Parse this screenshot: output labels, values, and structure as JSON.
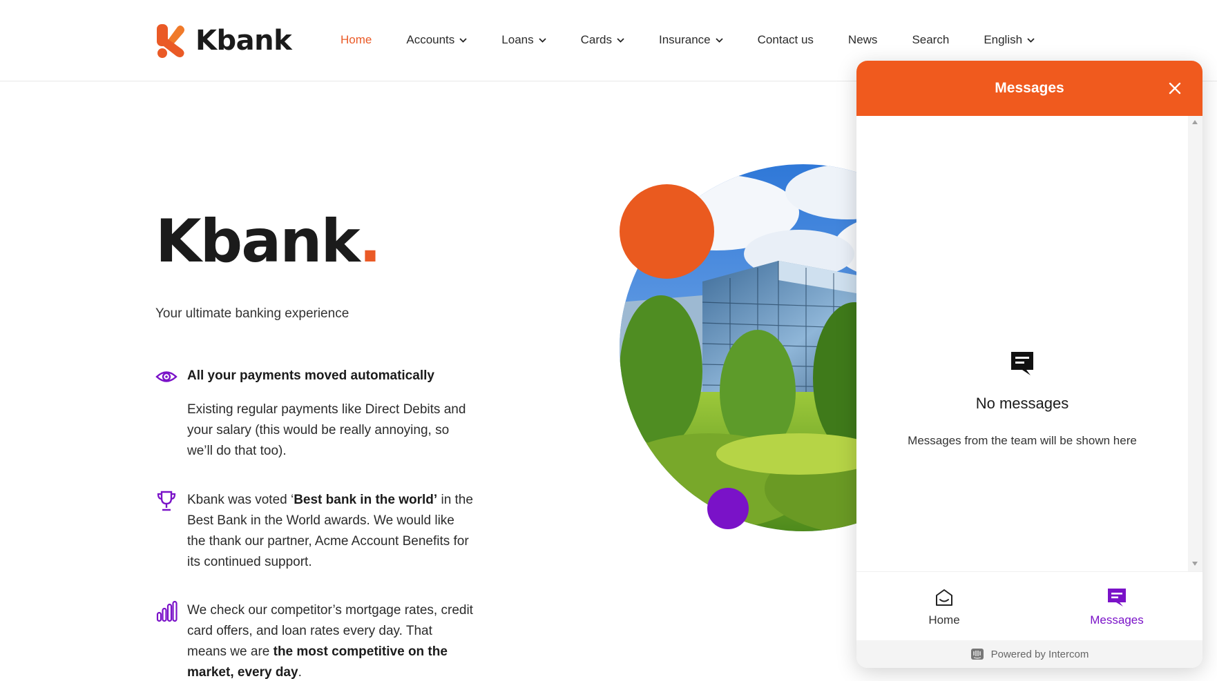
{
  "brand": {
    "name": "Kbank",
    "accent": "#ea5a26",
    "purple": "#7a12c8"
  },
  "nav": {
    "items": [
      {
        "label": "Home",
        "active": true,
        "dropdown": false
      },
      {
        "label": "Accounts",
        "dropdown": true
      },
      {
        "label": "Loans",
        "dropdown": true
      },
      {
        "label": "Cards",
        "dropdown": true
      },
      {
        "label": "Insurance",
        "dropdown": true
      },
      {
        "label": "Contact us",
        "dropdown": false
      },
      {
        "label": "News",
        "dropdown": false
      },
      {
        "label": "Search",
        "dropdown": false
      },
      {
        "label": "English",
        "dropdown": true
      }
    ]
  },
  "hero": {
    "title": "Kbank",
    "title_dot": ".",
    "subtitle": "Your ultimate banking experience"
  },
  "features": [
    {
      "icon": "eye-icon",
      "heading": "All your payments moved automatically",
      "text": "Existing regular payments like Direct Debits and your salary (this would be really annoying, so we’ll do that too)."
    },
    {
      "icon": "trophy-icon",
      "text_before": "Kbank was voted ‘",
      "text_bold": "Best bank in the world’",
      "text_after": " in the Best Bank in the World awards. We would like the thank our partner, Acme Account Benefits for its continued support."
    },
    {
      "icon": "bar-chart-icon",
      "text_before": "We check our competitor’s mortgage rates, credit card offers, and loan rates every day. That means we are ",
      "text_bold": "the most competitive on the market, every day",
      "text_after": "."
    }
  ],
  "messenger": {
    "title": "Messages",
    "header_color": "#f05a1e",
    "empty_title": "No messages",
    "empty_subtitle": "Messages from the team will be shown here",
    "tabs": [
      {
        "label": "Home",
        "icon": "home-icon"
      },
      {
        "label": "Messages",
        "icon": "messages-icon",
        "active": true
      }
    ],
    "powered_by": "Powered by Intercom"
  }
}
